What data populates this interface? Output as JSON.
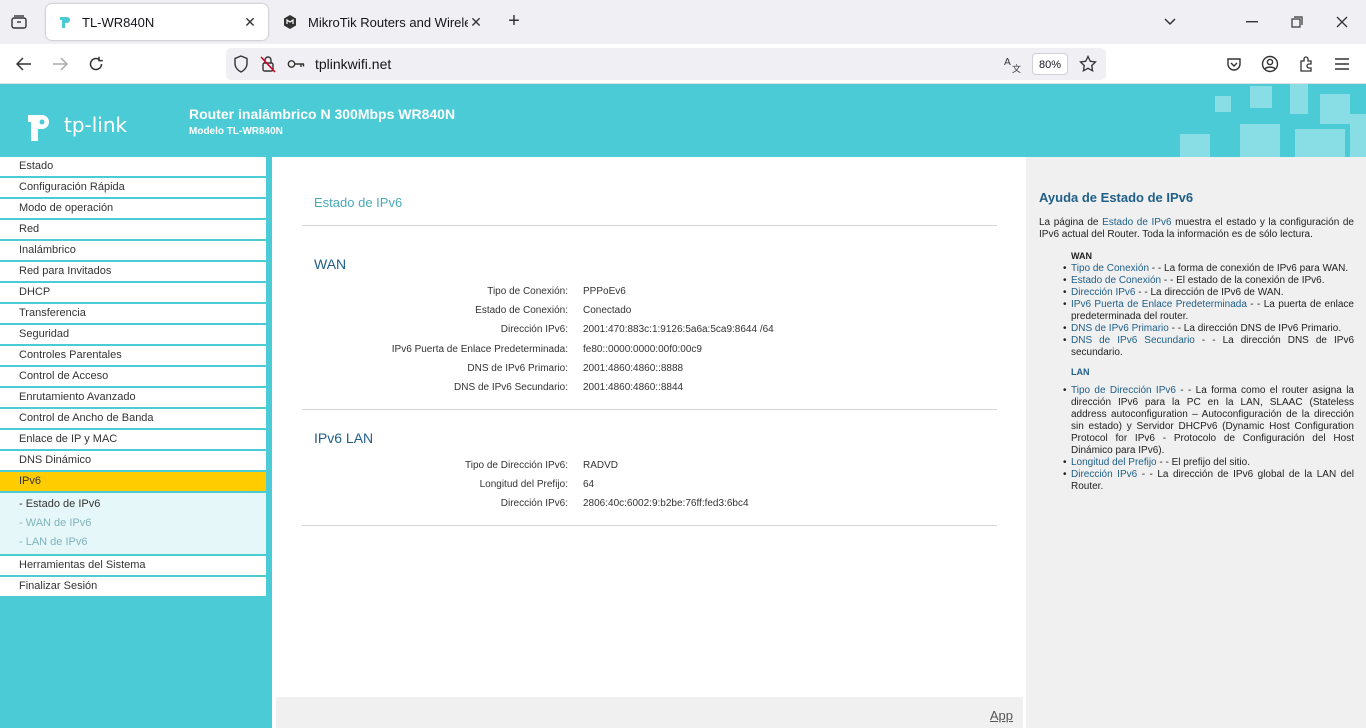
{
  "browser": {
    "tabs": [
      {
        "title": "TL-WR840N",
        "active": true
      },
      {
        "title": "MikroTik Routers and Wireless",
        "active": false
      }
    ],
    "url": "tplinkwifi.net",
    "zoom": "80%"
  },
  "header": {
    "logo_text": "tp-link",
    "title": "Router inalámbrico N 300Mbps WR840N",
    "subtitle": "Modelo TL-WR840N",
    "colors": {
      "accent": "#4acbd6",
      "active_menu": "#ffcc00"
    }
  },
  "menu": {
    "items": [
      "Estado",
      "Configuración Rápida",
      "Modo de operación",
      "Red",
      "Inalámbrico",
      "Red para Invitados",
      "DHCP",
      "Transferencia",
      "Seguridad",
      "Controles Parentales",
      "Control de Acceso",
      "Enrutamiento Avanzado",
      "Control de Ancho de Banda",
      "Enlace de IP y MAC",
      "DNS Dinámico"
    ],
    "active": "IPv6",
    "sub_items": [
      "- Estado de IPv6",
      "- WAN de IPv6",
      "- LAN de IPv6"
    ],
    "after_items": [
      "Herramientas del Sistema",
      "Finalizar Sesión"
    ]
  },
  "main": {
    "title": "Estado de IPv6",
    "wan": {
      "title": "WAN",
      "rows": [
        {
          "label": "Tipo de Conexión:",
          "value": "PPPoEv6"
        },
        {
          "label": "Estado de Conexión:",
          "value": "Conectado"
        },
        {
          "label": "Dirección IPv6:",
          "value": "2001:470:883c:1:9126:5a6a:5ca9:8644 /64"
        },
        {
          "label": "IPv6 Puerta de Enlace Predeterminada:",
          "value": "fe80::0000:0000:00f0:00c9"
        },
        {
          "label": "DNS de IPv6 Primario:",
          "value": "2001:4860:4860::8888"
        },
        {
          "label": "DNS de IPv6 Secundario:",
          "value": "2001:4860:4860::8844"
        }
      ]
    },
    "lan": {
      "title": "IPv6 LAN",
      "rows": [
        {
          "label": "Tipo de Dirección IPv6:",
          "value": "RADVD"
        },
        {
          "label": "Longitud del Prefijo:",
          "value": "64"
        },
        {
          "label": "Dirección IPv6:",
          "value": "2806:40c:6002:9:b2be:76ff:fed3:6bc4"
        }
      ]
    },
    "footer_link": "App"
  },
  "help": {
    "title": "Ayuda de Estado de IPv6",
    "intro_pre": "La página de ",
    "intro_key": "Estado de IPv6",
    "intro_post": " muestra el estado y la configuración de IPv6 actual del Router. Toda la información es de sólo lectura.",
    "wan_title": "WAN",
    "wan_items": [
      {
        "k": "Tipo de Conexión",
        "v": " - - La forma de conexión de IPv6 para WAN."
      },
      {
        "k": "Estado de Conexión",
        "v": " - - El estado de la conexión de IPv6."
      },
      {
        "k": "Dirección IPv6",
        "v": " - - La dirección de IPv6 de WAN."
      },
      {
        "k": "IPv6 Puerta de Enlace Predeterminada",
        "v": " - - La puerta de enlace predeterminada del router."
      },
      {
        "k": "DNS de IPv6 Primario",
        "v": " - - La dirección DNS de IPv6 Primario."
      },
      {
        "k": "DNS de IPv6 Secundario",
        "v": " - - La dirección DNS de IPv6 secundario."
      }
    ],
    "lan_title": "LAN",
    "lan_items": [
      {
        "k": "Tipo de Dirección IPv6",
        "v": " - - La forma como el router asigna la dirección IPv6 para la PC en la LAN, SLAAC (Stateless address autoconfiguration – Autoconfiguración de la dirección sin estado) y Servidor DHCPv6 (Dynamic Host Configuration Protocol for IPv6 - Protocolo de Configuración del Host Dinámico para IPv6)."
      },
      {
        "k": "Longitud del Prefijo",
        "v": " - - El prefijo del sitio."
      },
      {
        "k": "Dirección IPv6",
        "v": " - - La dirección de IPv6 global de la LAN del Router."
      }
    ]
  }
}
